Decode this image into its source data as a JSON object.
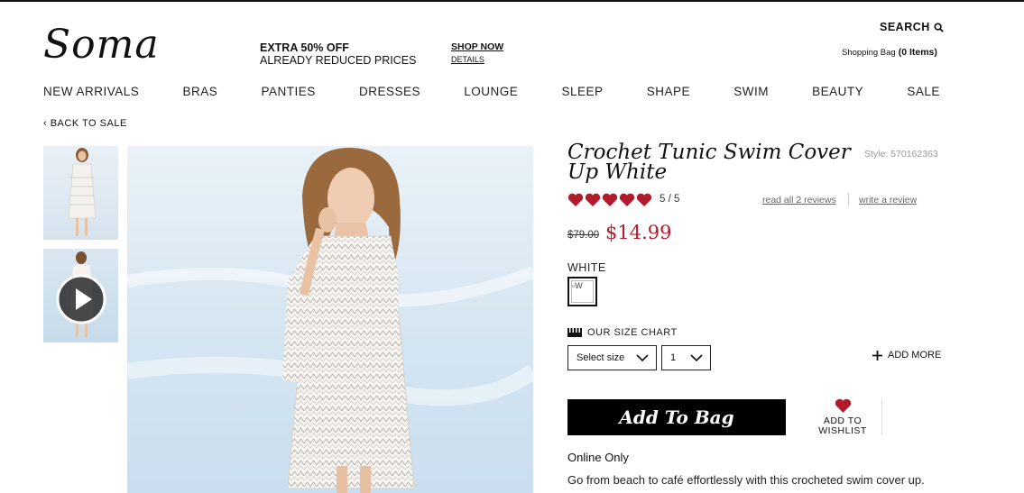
{
  "brand": {
    "logo": "Soma"
  },
  "promo": {
    "line1": "EXTRA 50% OFF",
    "line2": "ALREADY REDUCED PRICES",
    "shop_now": "SHOP NOW",
    "details": "DETAILS"
  },
  "header": {
    "search_label": "SEARCH",
    "search_icon": "search-icon",
    "bag_label": "Shopping Bag",
    "bag_count": "(0 Items)"
  },
  "nav": {
    "items": [
      "NEW ARRIVALS",
      "BRAS",
      "PANTIES",
      "DRESSES",
      "LOUNGE",
      "SLEEP",
      "SHAPE",
      "SWIM",
      "BEAUTY",
      "SALE"
    ]
  },
  "breadcrumb": {
    "back_label": "‹ BACK TO SALE"
  },
  "product": {
    "title": "Crochet Tunic Swim Cover Up White",
    "style": "Style: 570162363",
    "rating_text": "5 / 5",
    "rating_value": 5,
    "rating_max": 5,
    "reviews_link": "read all 2 reviews",
    "write_review_link": "write a review",
    "old_price": "$79.00",
    "new_price": "$14.99",
    "color_name": "WHITE",
    "swatch_alt": "W",
    "size_chart_label": "OUR SIZE CHART",
    "size_select_value": "Select size",
    "qty_select_value": "1",
    "add_more_label": "ADD MORE",
    "add_to_bag_label": "Add To Bag",
    "wishlist_line1": "ADD TO",
    "wishlist_line2": "WISHLIST",
    "availability": "Online Only",
    "description": "Go from beach to café effortlessly with this crocheted swim cover up."
  },
  "colors": {
    "price_red": "#b11b2b",
    "heart_red": "#b11b2b",
    "button_black": "#000000",
    "sky_blue": "#cfe2f1"
  }
}
